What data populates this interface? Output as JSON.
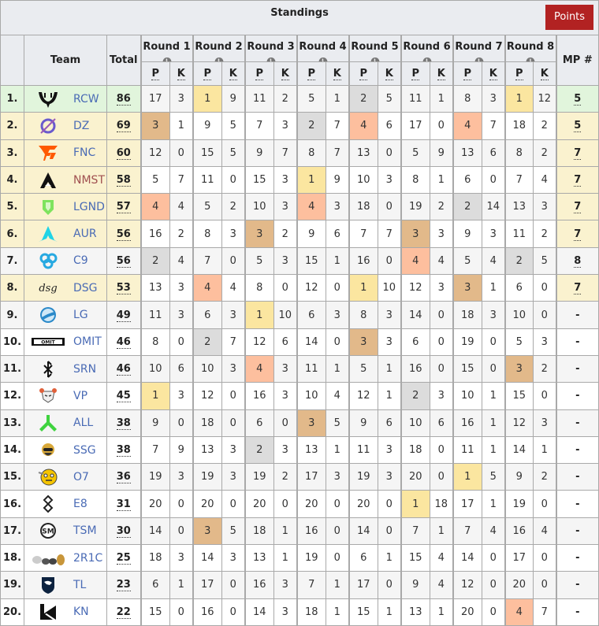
{
  "title": "Standings",
  "points_button": "Points",
  "headers": {
    "team": "Team",
    "total": "Total",
    "mp": "MP #",
    "placement_abbr": "P",
    "kills_abbr": "K",
    "info_icon": "i",
    "rounds": [
      "Round 1",
      "Round 2",
      "Round 3",
      "Round 4",
      "Round 5",
      "Round 6",
      "Round 7",
      "Round 8"
    ]
  },
  "colors": {
    "first_place": "#fbe6a0",
    "second_place": "#dcdcdc",
    "third_place": "#e2b98a",
    "fourth_place": "#fdbf9e",
    "match_point_winner_row": "#e1f5dc",
    "match_point_row": "#faf2cf",
    "points_button": "#b22222"
  },
  "rows": [
    {
      "rank": "1.",
      "team": "RCW",
      "logo": "rcw-logo",
      "total": "86",
      "mp": "5",
      "status": "green",
      "rounds": [
        [
          17,
          3
        ],
        [
          1,
          9
        ],
        [
          11,
          2
        ],
        [
          5,
          1
        ],
        [
          2,
          5
        ],
        [
          11,
          1
        ],
        [
          8,
          3
        ],
        [
          1,
          12
        ]
      ]
    },
    {
      "rank": "2.",
      "team": "DZ",
      "logo": "dz-logo",
      "total": "69",
      "mp": "5",
      "status": "yellow",
      "rounds": [
        [
          3,
          1
        ],
        [
          9,
          5
        ],
        [
          7,
          3
        ],
        [
          2,
          7
        ],
        [
          4,
          6
        ],
        [
          17,
          0
        ],
        [
          4,
          7
        ],
        [
          18,
          2
        ]
      ]
    },
    {
      "rank": "3.",
      "team": "FNC",
      "logo": "fnc-logo",
      "total": "60",
      "mp": "7",
      "status": "yellow",
      "rounds": [
        [
          12,
          0
        ],
        [
          15,
          5
        ],
        [
          9,
          7
        ],
        [
          8,
          7
        ],
        [
          13,
          0
        ],
        [
          5,
          9
        ],
        [
          13,
          6
        ],
        [
          8,
          2
        ]
      ]
    },
    {
      "rank": "4.",
      "team": "NMST",
      "logo": "nmst-logo",
      "total": "58",
      "mp": "7",
      "status": "yellow",
      "rounds": [
        [
          5,
          7
        ],
        [
          11,
          0
        ],
        [
          15,
          3
        ],
        [
          1,
          9
        ],
        [
          10,
          3
        ],
        [
          8,
          1
        ],
        [
          6,
          0
        ],
        [
          7,
          4
        ]
      ]
    },
    {
      "rank": "5.",
      "team": "LGND",
      "logo": "lgnd-logo",
      "total": "57",
      "mp": "7",
      "status": "yellow",
      "rounds": [
        [
          4,
          4
        ],
        [
          5,
          2
        ],
        [
          10,
          3
        ],
        [
          4,
          3
        ],
        [
          18,
          0
        ],
        [
          19,
          2
        ],
        [
          2,
          14
        ],
        [
          13,
          3
        ]
      ]
    },
    {
      "rank": "6.",
      "team": "AUR",
      "logo": "aur-logo",
      "total": "56",
      "mp": "7",
      "status": "yellow",
      "rounds": [
        [
          16,
          2
        ],
        [
          8,
          3
        ],
        [
          3,
          2
        ],
        [
          9,
          6
        ],
        [
          7,
          7
        ],
        [
          3,
          3
        ],
        [
          9,
          3
        ],
        [
          11,
          2
        ]
      ]
    },
    {
      "rank": "7.",
      "team": "C9",
      "logo": "c9-logo",
      "total": "56",
      "mp": "8",
      "status": "plain",
      "rounds": [
        [
          2,
          4
        ],
        [
          7,
          0
        ],
        [
          5,
          3
        ],
        [
          15,
          1
        ],
        [
          16,
          0
        ],
        [
          4,
          4
        ],
        [
          5,
          4
        ],
        [
          2,
          5
        ]
      ]
    },
    {
      "rank": "8.",
      "team": "DSG",
      "logo": "dsg-logo",
      "total": "53",
      "mp": "7",
      "status": "yellow",
      "rounds": [
        [
          13,
          3
        ],
        [
          4,
          4
        ],
        [
          8,
          0
        ],
        [
          12,
          0
        ],
        [
          1,
          10
        ],
        [
          12,
          3
        ],
        [
          3,
          1
        ],
        [
          6,
          0
        ]
      ]
    },
    {
      "rank": "9.",
      "team": "LG",
      "logo": "lg-logo",
      "total": "49",
      "mp": "-",
      "status": "plain",
      "rounds": [
        [
          11,
          3
        ],
        [
          6,
          3
        ],
        [
          1,
          10
        ],
        [
          6,
          3
        ],
        [
          8,
          3
        ],
        [
          14,
          0
        ],
        [
          18,
          3
        ],
        [
          10,
          0
        ]
      ]
    },
    {
      "rank": "10.",
      "team": "OMIT",
      "logo": "omit-logo",
      "total": "46",
      "mp": "-",
      "status": "plain",
      "rounds": [
        [
          8,
          0
        ],
        [
          2,
          7
        ],
        [
          12,
          6
        ],
        [
          14,
          0
        ],
        [
          3,
          3
        ],
        [
          6,
          0
        ],
        [
          19,
          0
        ],
        [
          5,
          3
        ]
      ]
    },
    {
      "rank": "11.",
      "team": "SRN",
      "logo": "srn-logo",
      "total": "46",
      "mp": "-",
      "status": "plain",
      "rounds": [
        [
          10,
          6
        ],
        [
          10,
          3
        ],
        [
          4,
          3
        ],
        [
          11,
          1
        ],
        [
          5,
          1
        ],
        [
          16,
          0
        ],
        [
          15,
          0
        ],
        [
          3,
          2
        ]
      ]
    },
    {
      "rank": "12.",
      "team": "VP",
      "logo": "vp-logo",
      "total": "45",
      "mp": "-",
      "status": "plain",
      "rounds": [
        [
          1,
          3
        ],
        [
          12,
          0
        ],
        [
          16,
          3
        ],
        [
          10,
          4
        ],
        [
          12,
          1
        ],
        [
          2,
          3
        ],
        [
          10,
          1
        ],
        [
          15,
          0
        ]
      ]
    },
    {
      "rank": "13.",
      "team": "ALL",
      "logo": "all-logo",
      "total": "38",
      "mp": "-",
      "status": "plain",
      "rounds": [
        [
          9,
          0
        ],
        [
          18,
          0
        ],
        [
          6,
          0
        ],
        [
          3,
          5
        ],
        [
          9,
          6
        ],
        [
          10,
          6
        ],
        [
          16,
          1
        ],
        [
          12,
          3
        ]
      ]
    },
    {
      "rank": "14.",
      "team": "SSG",
      "logo": "ssg-logo",
      "total": "38",
      "mp": "-",
      "status": "plain",
      "rounds": [
        [
          7,
          9
        ],
        [
          13,
          3
        ],
        [
          2,
          3
        ],
        [
          13,
          1
        ],
        [
          11,
          3
        ],
        [
          18,
          0
        ],
        [
          11,
          1
        ],
        [
          14,
          1
        ]
      ]
    },
    {
      "rank": "15.",
      "team": "O7",
      "logo": "o7-logo",
      "total": "36",
      "mp": "-",
      "status": "plain",
      "rounds": [
        [
          19,
          3
        ],
        [
          19,
          3
        ],
        [
          19,
          2
        ],
        [
          17,
          3
        ],
        [
          19,
          3
        ],
        [
          20,
          0
        ],
        [
          1,
          5
        ],
        [
          9,
          2
        ]
      ]
    },
    {
      "rank": "16.",
      "team": "E8",
      "logo": "e8-logo",
      "total": "31",
      "mp": "-",
      "status": "plain",
      "rounds": [
        [
          20,
          0
        ],
        [
          20,
          0
        ],
        [
          20,
          0
        ],
        [
          20,
          0
        ],
        [
          20,
          0
        ],
        [
          1,
          18
        ],
        [
          17,
          1
        ],
        [
          19,
          0
        ]
      ]
    },
    {
      "rank": "17.",
      "team": "TSM",
      "logo": "tsm-logo",
      "total": "30",
      "mp": "-",
      "status": "plain",
      "rounds": [
        [
          14,
          0
        ],
        [
          3,
          5
        ],
        [
          18,
          1
        ],
        [
          16,
          0
        ],
        [
          14,
          0
        ],
        [
          7,
          1
        ],
        [
          7,
          4
        ],
        [
          16,
          4
        ]
      ]
    },
    {
      "rank": "18.",
      "team": "2R1C",
      "logo": "2r1c-logo",
      "total": "25",
      "mp": "-",
      "status": "plain",
      "rounds": [
        [
          18,
          3
        ],
        [
          14,
          3
        ],
        [
          13,
          1
        ],
        [
          19,
          0
        ],
        [
          6,
          1
        ],
        [
          15,
          4
        ],
        [
          14,
          0
        ],
        [
          17,
          0
        ]
      ]
    },
    {
      "rank": "19.",
      "team": "TL",
      "logo": "tl-logo",
      "total": "23",
      "mp": "-",
      "status": "plain",
      "rounds": [
        [
          6,
          1
        ],
        [
          17,
          0
        ],
        [
          16,
          3
        ],
        [
          7,
          1
        ],
        [
          17,
          0
        ],
        [
          9,
          4
        ],
        [
          12,
          0
        ],
        [
          20,
          0
        ]
      ]
    },
    {
      "rank": "20.",
      "team": "KN",
      "logo": "kn-logo",
      "total": "22",
      "mp": "-",
      "status": "plain",
      "rounds": [
        [
          15,
          0
        ],
        [
          16,
          0
        ],
        [
          14,
          3
        ],
        [
          18,
          1
        ],
        [
          15,
          1
        ],
        [
          13,
          1
        ],
        [
          20,
          0
        ],
        [
          4,
          7
        ]
      ]
    }
  ]
}
